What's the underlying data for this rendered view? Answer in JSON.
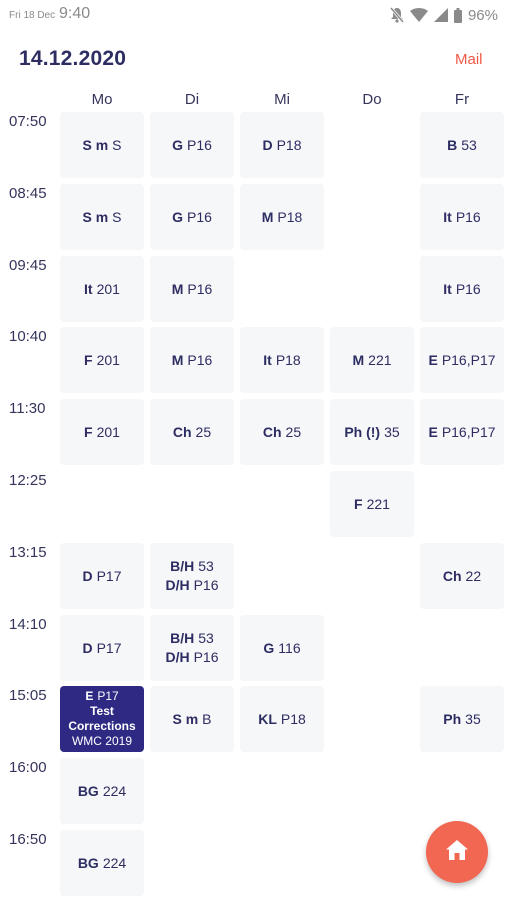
{
  "status_bar": {
    "date": "Fri 18 Dec",
    "time": "9:40",
    "battery": "96%",
    "icons": [
      "notifications-off-icon",
      "wifi-icon",
      "signal-icon",
      "battery-icon"
    ]
  },
  "header": {
    "date": "14.12.2020",
    "mail_label": "Mail"
  },
  "days": [
    "Mo",
    "Di",
    "Mi",
    "Do",
    "Fr"
  ],
  "times": [
    "07:50",
    "08:45",
    "09:45",
    "10:40",
    "11:30",
    "12:25",
    "13:15",
    "14:10",
    "15:05",
    "16:00",
    "16:50"
  ],
  "periods": [
    {
      "cells": [
        {
          "subj": "S m",
          "room": "S"
        },
        {
          "subj": "G",
          "room": "P16"
        },
        {
          "subj": "D",
          "room": "P18"
        },
        null,
        {
          "subj": "B",
          "room": "53"
        }
      ]
    },
    {
      "cells": [
        {
          "subj": "S m",
          "room": "S"
        },
        {
          "subj": "G",
          "room": "P16"
        },
        {
          "subj": "M",
          "room": "P18"
        },
        null,
        {
          "subj": "It",
          "room": "P16"
        }
      ]
    },
    {
      "cells": [
        {
          "subj": "It",
          "room": "201"
        },
        {
          "subj": "M",
          "room": "P16"
        },
        null,
        null,
        {
          "subj": "It",
          "room": "P16"
        }
      ]
    },
    {
      "cells": [
        {
          "subj": "F",
          "room": "201"
        },
        {
          "subj": "M",
          "room": "P16"
        },
        {
          "subj": "It",
          "room": "P18"
        },
        {
          "subj": "M",
          "room": "221"
        },
        {
          "subj": "E",
          "room": "P16,P17"
        }
      ]
    },
    {
      "cells": [
        {
          "subj": "F",
          "room": "201"
        },
        {
          "subj": "Ch",
          "room": "25"
        },
        {
          "subj": "Ch",
          "room": "25"
        },
        {
          "subj": "Ph (!)",
          "room": "35"
        },
        {
          "subj": "E",
          "room": "P16,P17"
        }
      ]
    },
    {
      "cells": [
        null,
        null,
        null,
        {
          "subj": "F",
          "room": "221"
        },
        null
      ]
    },
    {
      "cells": [
        {
          "subj": "D",
          "room": "P17"
        },
        {
          "lines": [
            {
              "subj": "B/H",
              "room": "53"
            },
            {
              "subj": "D/H",
              "room": "P16"
            }
          ]
        },
        null,
        null,
        {
          "subj": "Ch",
          "room": "22"
        }
      ]
    },
    {
      "cells": [
        {
          "subj": "D",
          "room": "P17"
        },
        {
          "lines": [
            {
              "subj": "B/H",
              "room": "53"
            },
            {
              "subj": "D/H",
              "room": "P16"
            }
          ]
        },
        {
          "subj": "G",
          "room": "116"
        },
        null,
        null
      ]
    },
    {
      "cells": [
        {
          "highlight": true,
          "subj": "E",
          "room": "P17",
          "note": [
            "Test",
            "Corrections"
          ],
          "extra": "WMC 2019"
        },
        {
          "subj": "S m",
          "room": "B"
        },
        {
          "subj": "KL",
          "room": "P18"
        },
        null,
        {
          "subj": "Ph",
          "room": "35"
        }
      ]
    },
    {
      "cells": [
        {
          "subj": "BG",
          "room": "224"
        },
        null,
        null,
        null,
        null
      ]
    },
    {
      "cells": [
        {
          "subj": "BG",
          "room": "224"
        },
        null,
        null,
        null,
        null
      ]
    }
  ],
  "fab": {
    "icon": "home-icon"
  },
  "colors": {
    "accent": "#ef5a45",
    "primary": "#2d2d62",
    "highlight": "#2e2a84",
    "cell_bg": "#f6f7f9"
  }
}
